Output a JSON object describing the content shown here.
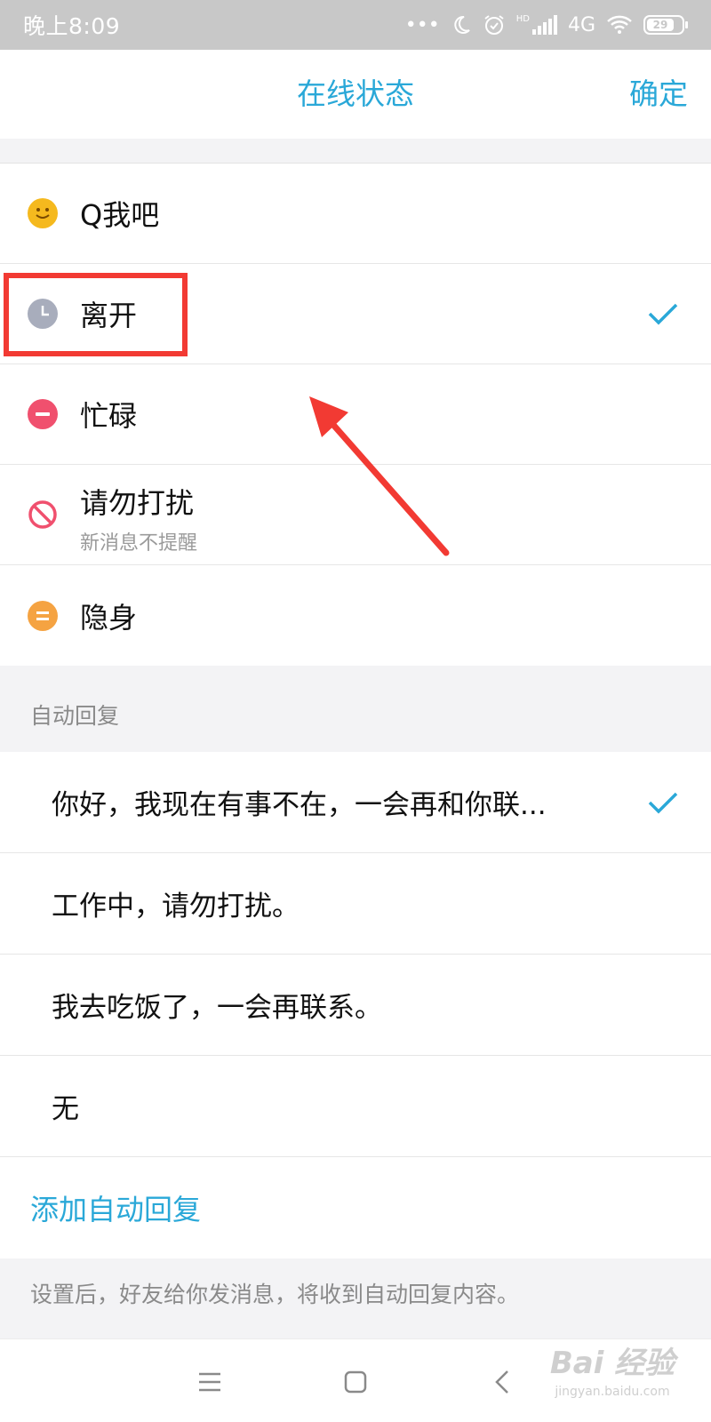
{
  "status_bar": {
    "time": "晚上8:09",
    "icons": [
      "dots-icon",
      "moon-icon",
      "alarm-icon",
      "hd-signal-icon",
      "4g-icon",
      "wifi-icon",
      "battery-icon"
    ],
    "network": "4G",
    "hd": "HD",
    "battery": "29"
  },
  "header": {
    "title": "在线状态",
    "confirm_label": "确定"
  },
  "status_options": [
    {
      "label": "Q我吧",
      "icon": "smile-icon",
      "color": "#f5b91e",
      "selected": false
    },
    {
      "label": "离开",
      "icon": "clock-icon",
      "color": "#a8adbc",
      "selected": true
    },
    {
      "label": "忙碌",
      "icon": "busy-icon",
      "color": "#f0506e",
      "selected": false
    },
    {
      "label": "请勿打扰",
      "sublabel": "新消息不提醒",
      "icon": "no-disturb-icon",
      "color": "#f0506e",
      "selected": false
    },
    {
      "label": "隐身",
      "icon": "invisible-icon",
      "color": "#f5a342",
      "selected": false
    }
  ],
  "auto_reply": {
    "section_label": "自动回复",
    "items": [
      {
        "label": "你好，我现在有事不在，一会再和你联...",
        "selected": true
      },
      {
        "label": "工作中，请勿打扰。",
        "selected": false
      },
      {
        "label": "我去吃饭了，一会再联系。",
        "selected": false
      },
      {
        "label": "无",
        "selected": false
      }
    ],
    "add_label": "添加自动回复",
    "footer_note": "设置后，好友给你发消息，将收到自动回复内容。"
  },
  "annotation": {
    "highlight_color": "#f23a33"
  },
  "accent_color": "#2aa8d8",
  "nav_bar": {
    "icons": [
      "menu-icon",
      "home-icon",
      "back-icon"
    ]
  },
  "watermark": {
    "brand": "Bai 经验",
    "url": "jingyan.baidu.com"
  }
}
